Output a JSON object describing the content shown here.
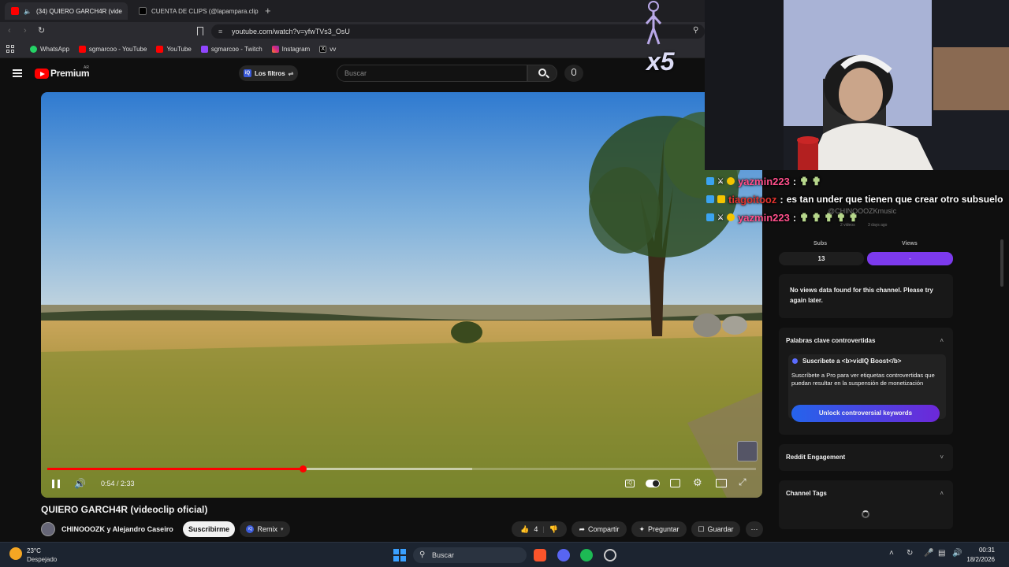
{
  "browser": {
    "tabs": [
      {
        "label": "(34) QUIERO GARCH4R (vide",
        "active": true
      },
      {
        "label": "CUENTA DE CLIPS (@lapampara.clips",
        "active": false
      }
    ],
    "new_tab": "+",
    "url": "youtube.com/watch?v=yfwTVs3_OsU",
    "bookmarks": [
      "WhatsApp",
      "sgmarcoo - YouTube",
      "YouTube",
      "sgmarcoo - Twitch",
      "Instagram",
      "vv"
    ]
  },
  "youtube": {
    "logo": "Premium",
    "logo_sup": "AR",
    "filter_button": "Los filtros",
    "search_placeholder": "Buscar",
    "video": {
      "time": "0:54 / 2:33",
      "progress": 0.36,
      "buffered": 0.6,
      "title": "QUIERO GARCH4R (videoclip oficial)",
      "channel": "CHINOOOZK y Alejandro Caseiro",
      "subscribe": "Suscribirme",
      "remix": "Remix",
      "likes": "4",
      "share": "Compartir",
      "ask": "Preguntar",
      "save": "Guardar"
    }
  },
  "overlay": {
    "multiplier": "x5"
  },
  "chat": [
    {
      "user": "yazmin223",
      "sep": ":",
      "message": "",
      "color": "#ff4f8b"
    },
    {
      "user": "tiagoitooz",
      "sep": ":",
      "message": "es tan under que tienen que crear otro subsuelo",
      "color": "#e3342f"
    },
    {
      "user": "yazmin223",
      "sep": ":",
      "message": "",
      "color": "#ff4f8b"
    }
  ],
  "vidiq": {
    "channel_handle": "@CHINOOOZKmusic",
    "videos_line": "2 videos",
    "age_line": "3 days ago",
    "subs_label": "Subs",
    "subs_value": "13",
    "views_label": "Views",
    "views_value": "-",
    "no_views": "No views data found for this channel. Please try again later.",
    "controversial_title": "Palabras clave controvertidas",
    "boost_text": "Suscribete a <b>vidIQ Boost</b>",
    "pro_text": "Suscríbete a Pro para ver etiquetas controvertidas que puedan resultar en la suspensión de monetización",
    "unlock_button": "Unlock controversial keywords",
    "reddit_title": "Reddit Engagement",
    "tags_title": "Channel Tags"
  },
  "taskbar": {
    "weather_temp": "23°C",
    "weather_desc": "Despejado",
    "search": "Buscar",
    "time": "00:31",
    "date": "18/2/2026"
  },
  "colors": {
    "accent": "#7c3aed",
    "unlock": "#2563eb",
    "progress": "#ff0000"
  }
}
